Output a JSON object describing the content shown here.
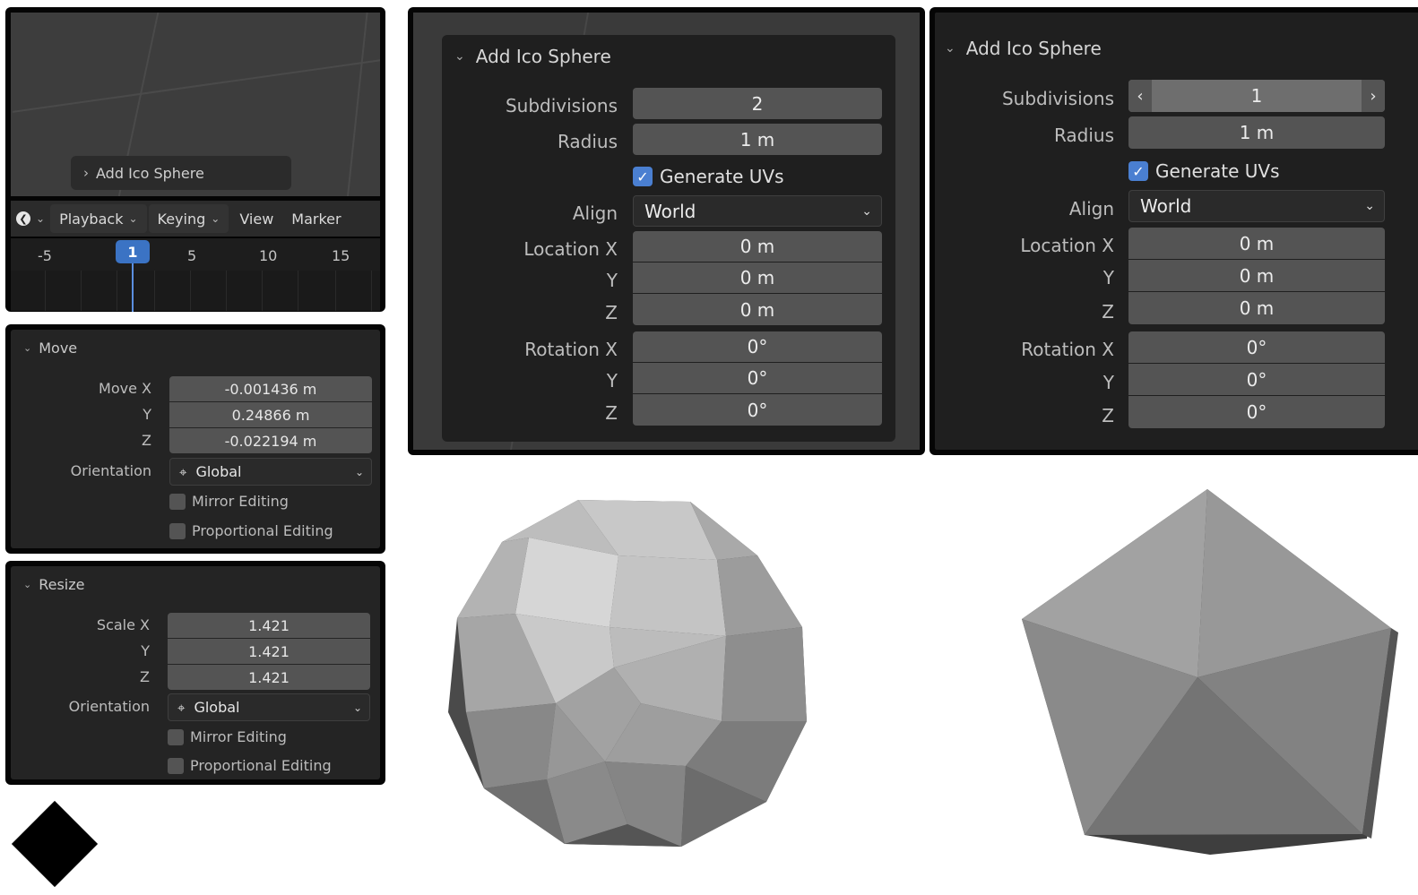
{
  "timeline": {
    "redo_panel_label": "Add Ico Sphere",
    "editor_icon": "clock-icon",
    "menus": [
      "Playback",
      "Keying",
      "View",
      "Marker"
    ],
    "ruler_ticks": [
      "-5",
      "5",
      "10",
      "15"
    ],
    "current_frame": "1"
  },
  "move": {
    "title": "Move",
    "labels": [
      "Move X",
      "Y",
      "Z"
    ],
    "values": [
      "-0.001436 m",
      "0.24866 m",
      "-0.022194 m"
    ],
    "orientation_label": "Orientation",
    "orientation_value": "Global",
    "mirror_label": "Mirror Editing",
    "proportional_label": "Proportional Editing"
  },
  "resize": {
    "title": "Resize",
    "labels": [
      "Scale X",
      "Y",
      "Z"
    ],
    "values": [
      "1.421",
      "1.421",
      "1.421"
    ],
    "orientation_label": "Orientation",
    "orientation_value": "Global",
    "mirror_label": "Mirror Editing",
    "proportional_label": "Proportional Editing"
  },
  "ico_left": {
    "title": "Add Ico Sphere",
    "subdivisions_label": "Subdivisions",
    "subdivisions_value": "2",
    "radius_label": "Radius",
    "radius_value": "1 m",
    "generate_uvs_label": "Generate UVs",
    "generate_uvs_checked": true,
    "align_label": "Align",
    "align_value": "World",
    "location_labels": [
      "Location X",
      "Y",
      "Z"
    ],
    "location_values": [
      "0 m",
      "0 m",
      "0 m"
    ],
    "rotation_labels": [
      "Rotation X",
      "Y",
      "Z"
    ],
    "rotation_values": [
      "0°",
      "0°",
      "0°"
    ]
  },
  "ico_right": {
    "title": "Add Ico Sphere",
    "subdivisions_label": "Subdivisions",
    "subdivisions_value": "1",
    "radius_label": "Radius",
    "radius_value": "1 m",
    "generate_uvs_label": "Generate UVs",
    "generate_uvs_checked": true,
    "align_label": "Align",
    "align_value": "World",
    "location_labels": [
      "Location X",
      "Y",
      "Z"
    ],
    "location_values": [
      "0 m",
      "0 m",
      "0 m"
    ],
    "rotation_labels": [
      "Rotation X",
      "Y",
      "Z"
    ],
    "rotation_values": [
      "0°",
      "0°",
      "0°"
    ]
  },
  "colors": {
    "accent": "#4a7fd1",
    "panel_bg": "#242424",
    "field_bg": "#545454",
    "frame_badge": "#3b73c4"
  }
}
